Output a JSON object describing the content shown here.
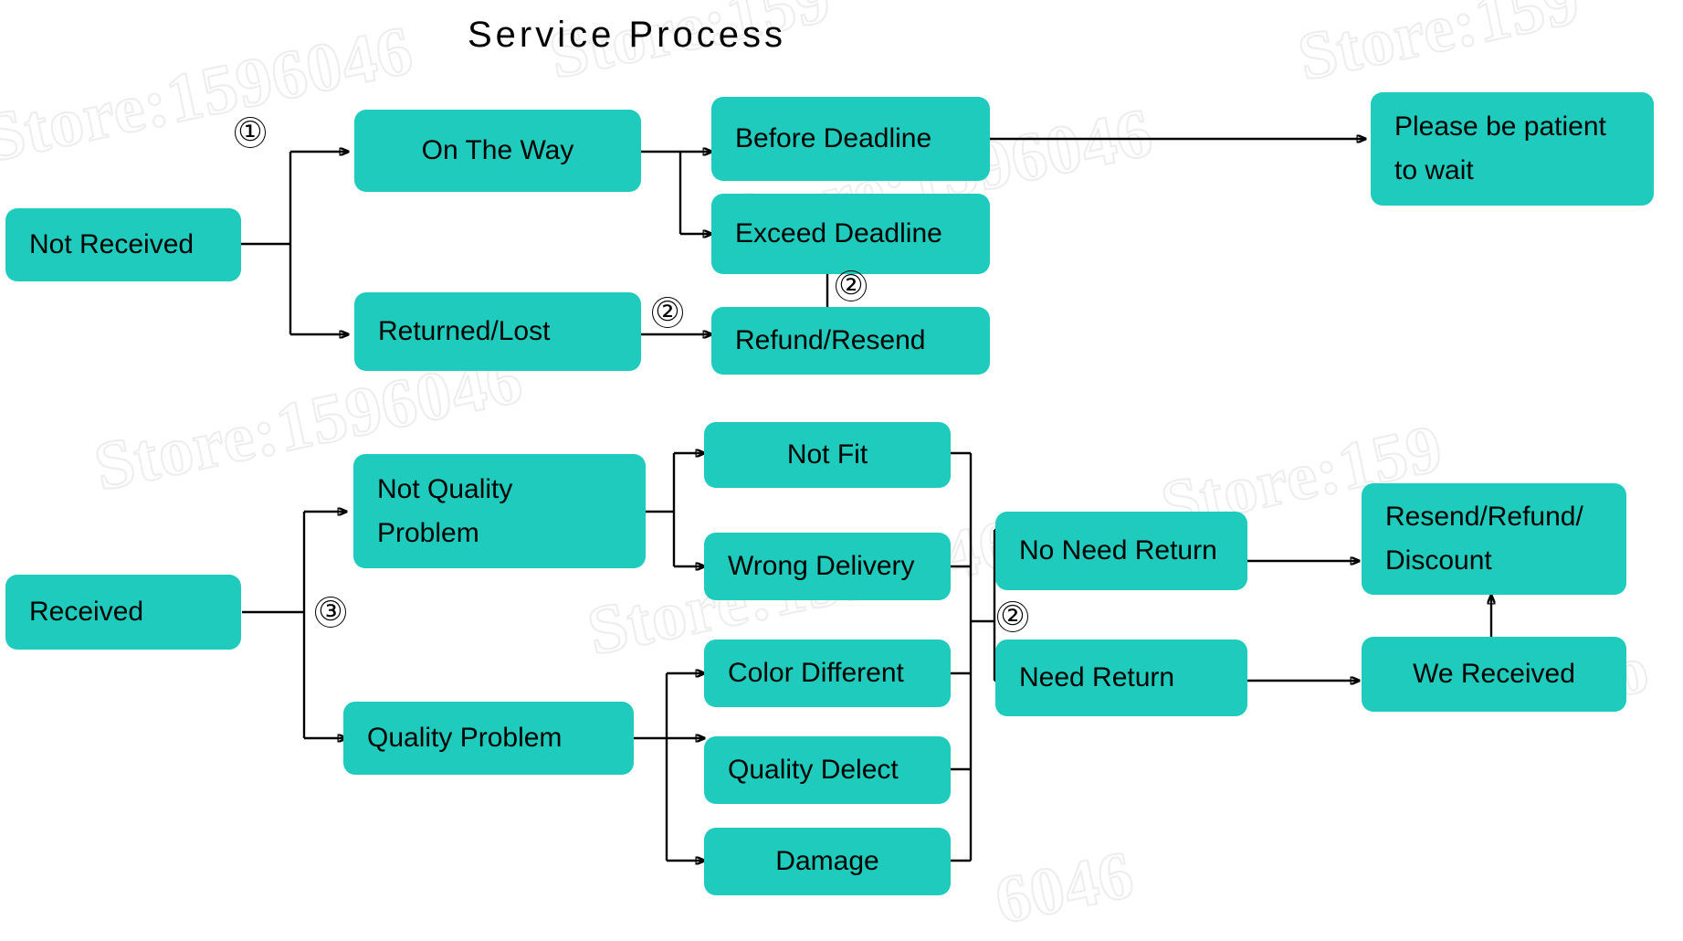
{
  "title": "Service Process",
  "colors": {
    "node_fill": "#1ecbbd",
    "line": "#000000",
    "background": "#ffffff",
    "watermark": "#ededed"
  },
  "watermark": {
    "text": "Store:1596046",
    "short_a": "Store:159",
    "short_b": "Sto",
    "short_c": "6046"
  },
  "nodes": {
    "not_received": "Not Received",
    "on_the_way": "On The Way",
    "returned_lost": "Returned/Lost",
    "before_deadline": "Before Deadline",
    "exceed_deadline": "Exceed Deadline",
    "refund_resend": "Refund/Resend",
    "please_wait_l1": "Please be patient",
    "please_wait_l2": "to wait",
    "received": "Received",
    "not_quality_l1": "Not Quality",
    "not_quality_l2": "Problem",
    "quality_problem": "Quality Problem",
    "not_fit": "Not Fit",
    "wrong_delivery": "Wrong Delivery",
    "color_different": "Color Different",
    "quality_delect": "Quality Delect",
    "damage": "Damage",
    "no_need_return": "No Need Return",
    "need_return": "Need Return",
    "resend_refund_l1": "Resend/Refund/",
    "resend_refund_l2": "Discount",
    "we_received": "We Received"
  },
  "markers": {
    "m1": "①",
    "m2_returned": "②",
    "m2_exceed": "②",
    "m3": "③",
    "m2_return_split": "②"
  },
  "flow": {
    "branch_top": "Not Received",
    "branch_bottom": "Received",
    "edges": [
      {
        "from": "Not Received",
        "to": "On The Way",
        "label": "①"
      },
      {
        "from": "Not Received",
        "to": "Returned/Lost",
        "label": ""
      },
      {
        "from": "On The Way",
        "to": "Before Deadline",
        "label": ""
      },
      {
        "from": "On The Way",
        "to": "Exceed Deadline",
        "label": ""
      },
      {
        "from": "Before Deadline",
        "to": "Please be patient to wait",
        "label": ""
      },
      {
        "from": "Exceed Deadline",
        "to": "Refund/Resend",
        "label": "②"
      },
      {
        "from": "Returned/Lost",
        "to": "Refund/Resend",
        "label": "②"
      },
      {
        "from": "Received",
        "to": "Not Quality Problem",
        "label": "③"
      },
      {
        "from": "Received",
        "to": "Quality Problem",
        "label": ""
      },
      {
        "from": "Not Quality Problem",
        "to": "Not Fit",
        "label": ""
      },
      {
        "from": "Not Quality Problem",
        "to": "Wrong Delivery",
        "label": ""
      },
      {
        "from": "Quality Problem",
        "to": "Color Different",
        "label": ""
      },
      {
        "from": "Quality Problem",
        "to": "Quality Delect",
        "label": ""
      },
      {
        "from": "Quality Problem",
        "to": "Damage",
        "label": ""
      },
      {
        "from": "Not Fit / Wrong Delivery / Color Different / Quality Delect / Damage",
        "to": "No Need Return",
        "label": "②"
      },
      {
        "from": "Not Fit / Wrong Delivery / Color Different / Quality Delect / Damage",
        "to": "Need Return",
        "label": "②"
      },
      {
        "from": "No Need Return",
        "to": "Resend/Refund/Discount",
        "label": ""
      },
      {
        "from": "Need Return",
        "to": "We Received",
        "label": ""
      },
      {
        "from": "We Received",
        "to": "Resend/Refund/Discount",
        "label": ""
      }
    ]
  }
}
